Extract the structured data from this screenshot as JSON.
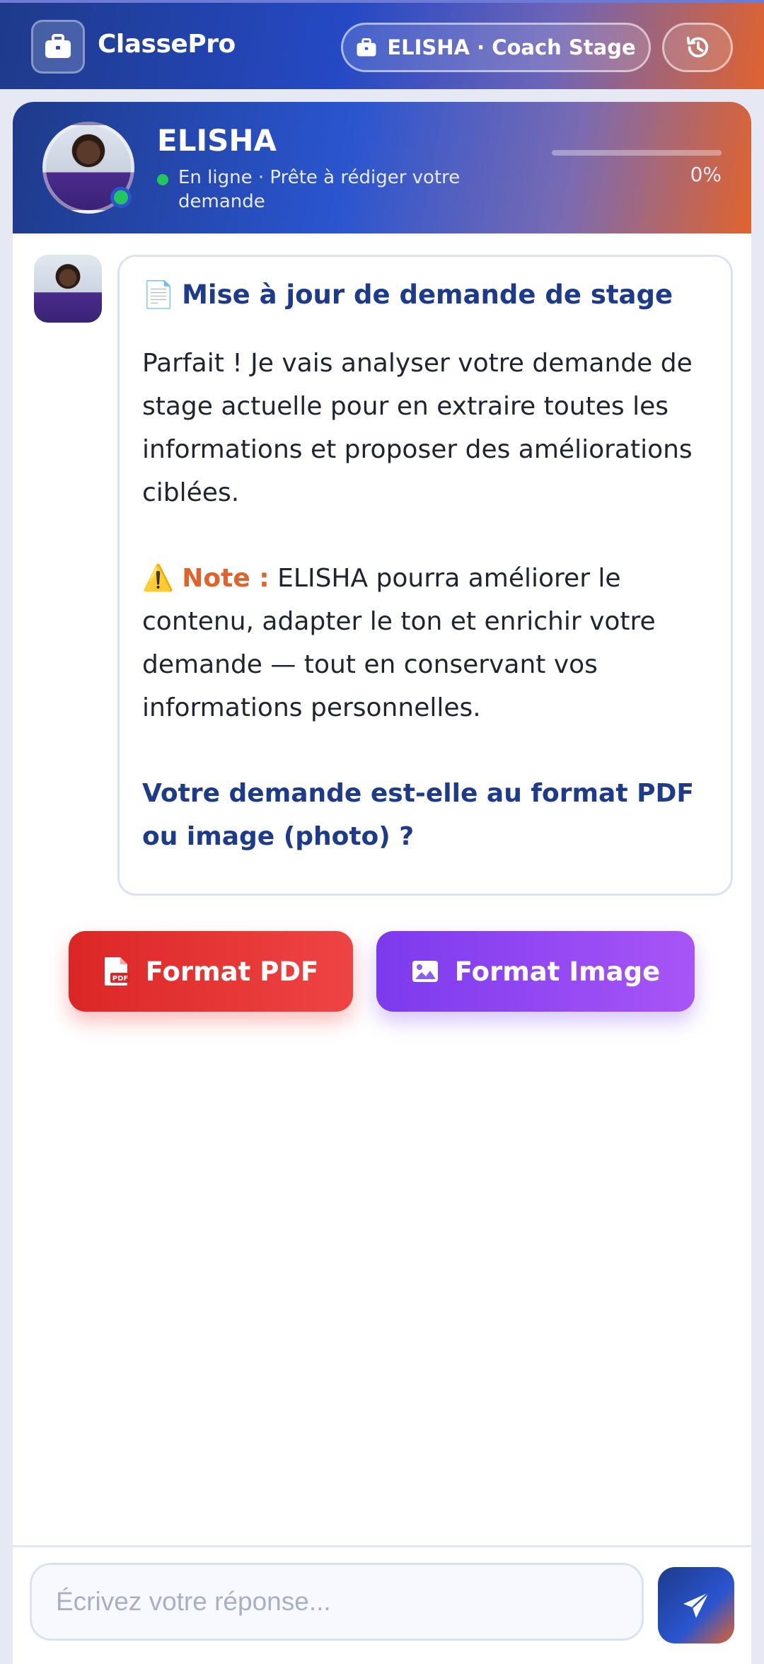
{
  "app": {
    "brand": "ClassePro",
    "coach_label": "ELISHA · Coach Stage",
    "accent_color": "#2549c4",
    "secondary_color": "#e0632e"
  },
  "icons": {
    "logo": "briefcase-icon",
    "coach_pill": "briefcase-icon",
    "history": "history-icon",
    "pdf": "file-pdf-icon",
    "image": "image-icon",
    "send": "paper-plane-icon",
    "title_emoji": "📄",
    "note_emoji": "⚠️"
  },
  "profile": {
    "name": "ELISHA",
    "status": "En ligne · Prête à rédiger votre demande",
    "status_color": "#22c55e",
    "progress_value": 0,
    "progress_label": "0%"
  },
  "message": {
    "title": "Mise à jour de demande de stage",
    "paragraph1": "Parfait ! Je vais analyser votre demande de stage actuelle pour en extraire toutes les informations et proposer des améliorations ciblées.",
    "note_label": "Note :",
    "note_text": " ELISHA pourra améliorer le contenu, adapter le ton et enrichir votre demande — tout en conservant vos informations personnelles.",
    "question": "Votre demande est-elle au format PDF ou image (photo) ?"
  },
  "choices": {
    "pdf_label": "Format PDF",
    "pdf_color": "#dc2626",
    "image_label": "Format Image",
    "image_color": "#7c3aed"
  },
  "composer": {
    "placeholder": "Écrivez votre réponse...",
    "value": ""
  }
}
